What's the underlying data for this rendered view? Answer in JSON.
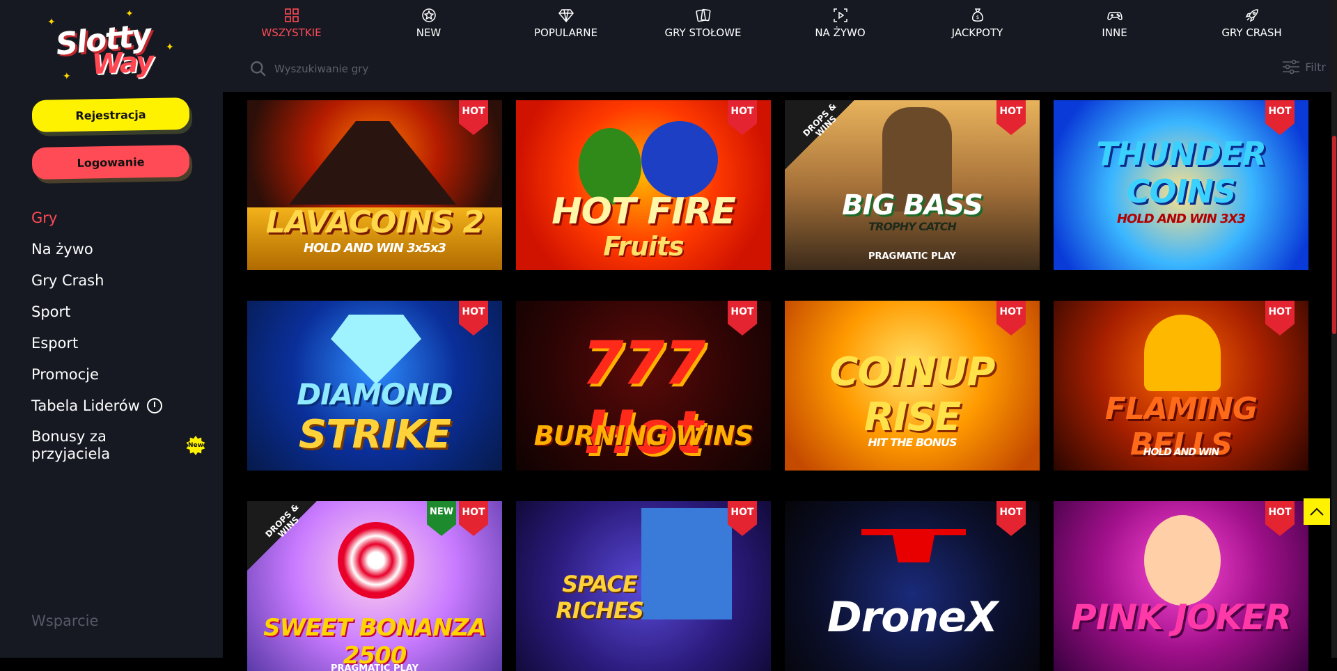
{
  "logo": {
    "line1": "Slotty",
    "line2": "Way"
  },
  "sidebar": {
    "register_label": "Rejestracja",
    "login_label": "Logowanie",
    "items": [
      {
        "label": "Gry",
        "active": true
      },
      {
        "label": "Na żywo"
      },
      {
        "label": "Gry Crash"
      },
      {
        "label": "Sport"
      },
      {
        "label": "Esport"
      },
      {
        "label": "Promocje"
      },
      {
        "label": "Tabela Liderów",
        "icon": "stopwatch-icon"
      },
      {
        "label": "Bonusy za przyjaciela",
        "badge": "New"
      }
    ],
    "support_label": "Wsparcie"
  },
  "categories": [
    {
      "label": "WSZYSTKIE",
      "icon": "grid-icon",
      "active": true
    },
    {
      "label": "NEW",
      "icon": "badge-star-icon"
    },
    {
      "label": "POPULARNE",
      "icon": "diamond-icon"
    },
    {
      "label": "GRY STOŁOWE",
      "icon": "cards-icon"
    },
    {
      "label": "NA ŻYWO",
      "icon": "live-play-icon"
    },
    {
      "label": "JACKPOTY",
      "icon": "money-bag-icon"
    },
    {
      "label": "INNE",
      "icon": "gamepad-icon"
    },
    {
      "label": "GRY CRASH",
      "icon": "rocket-icon"
    }
  ],
  "search": {
    "placeholder": "Wyszukiwanie gry"
  },
  "filter": {
    "label": "Filtr"
  },
  "games": [
    {
      "title": "LAVACOINS 2",
      "subtitle": "HOLD AND WIN 3x5x3",
      "hot": "HOT"
    },
    {
      "title": "HOT FIRE",
      "subtitle": "Fruits",
      "hot": "HOT"
    },
    {
      "title": "BIG BASS",
      "subtitle": "TROPHY CATCH",
      "hot": "HOT",
      "drops": "DROPS & WINS",
      "provider": "PRAGMATIC PLAY"
    },
    {
      "title": "THUNDER COINS",
      "subtitle": "HOLD AND WIN 3X3",
      "hot": "HOT"
    },
    {
      "title": "DIAMOND",
      "subtitle": "STRIKE",
      "hot": "HOT"
    },
    {
      "title": "777 Hot",
      "subtitle": "BURNING WINS",
      "hot": "HOT"
    },
    {
      "title": "COINUP RISE",
      "subtitle": "HIT THE BONUS",
      "hot": "HOT"
    },
    {
      "title": "FLAMING BELLS",
      "subtitle": "HOLD AND WIN",
      "hot": "HOT"
    },
    {
      "title": "SWEET BONANZA 2500",
      "subtitle": "",
      "hot": "HOT",
      "new": "NEW",
      "drops": "DROPS & WINS",
      "provider": "PRAGMATIC PLAY"
    },
    {
      "title": "SPACE RICHES",
      "subtitle": "",
      "hot": "HOT"
    },
    {
      "title": "DroneX",
      "subtitle": "",
      "hot": "HOT"
    },
    {
      "title": "PINK JOKER",
      "subtitle": "",
      "hot": "HOT"
    }
  ]
}
